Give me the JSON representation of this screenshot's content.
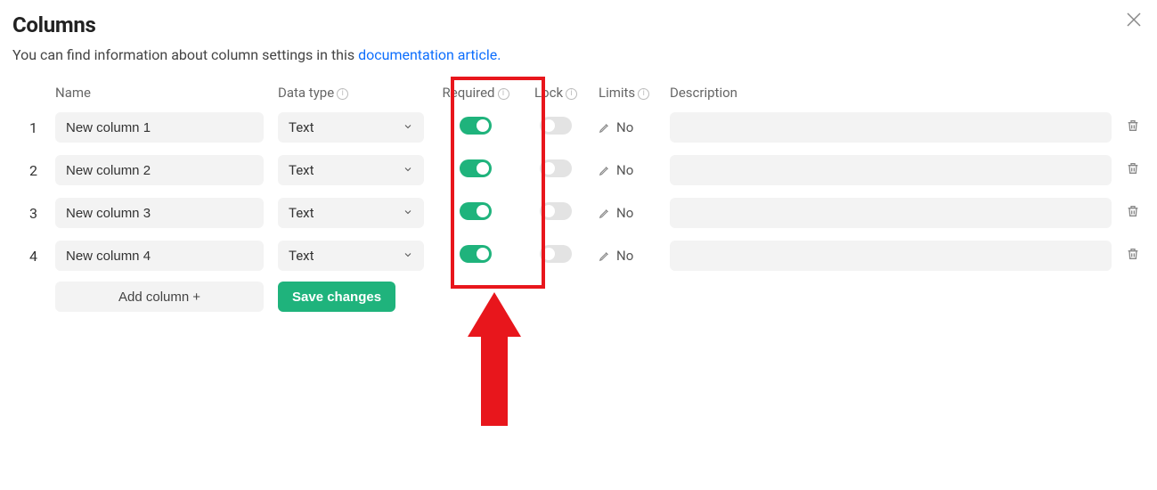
{
  "title": "Columns",
  "subtitle_prefix": "You can find information about column settings in this ",
  "subtitle_link": "documentation article.",
  "headers": {
    "name": "Name",
    "type": "Data type",
    "required": "Required",
    "lock": "Lock",
    "limits": "Limits",
    "description": "Description"
  },
  "rows": [
    {
      "idx": "1",
      "name": "New column 1",
      "type": "Text",
      "required": true,
      "lock": false,
      "limits": "No",
      "desc": ""
    },
    {
      "idx": "2",
      "name": "New column 2",
      "type": "Text",
      "required": true,
      "lock": false,
      "limits": "No",
      "desc": ""
    },
    {
      "idx": "3",
      "name": "New column 3",
      "type": "Text",
      "required": true,
      "lock": false,
      "limits": "No",
      "desc": ""
    },
    {
      "idx": "4",
      "name": "New column 4",
      "type": "Text",
      "required": true,
      "lock": false,
      "limits": "No",
      "desc": ""
    }
  ],
  "add_label": "Add column",
  "save_label": "Save changes",
  "colors": {
    "accent": "#1fb37c",
    "danger": "#e8161c",
    "link": "#0d6efd"
  },
  "annotation": {
    "highlight": "Required column toggles"
  }
}
